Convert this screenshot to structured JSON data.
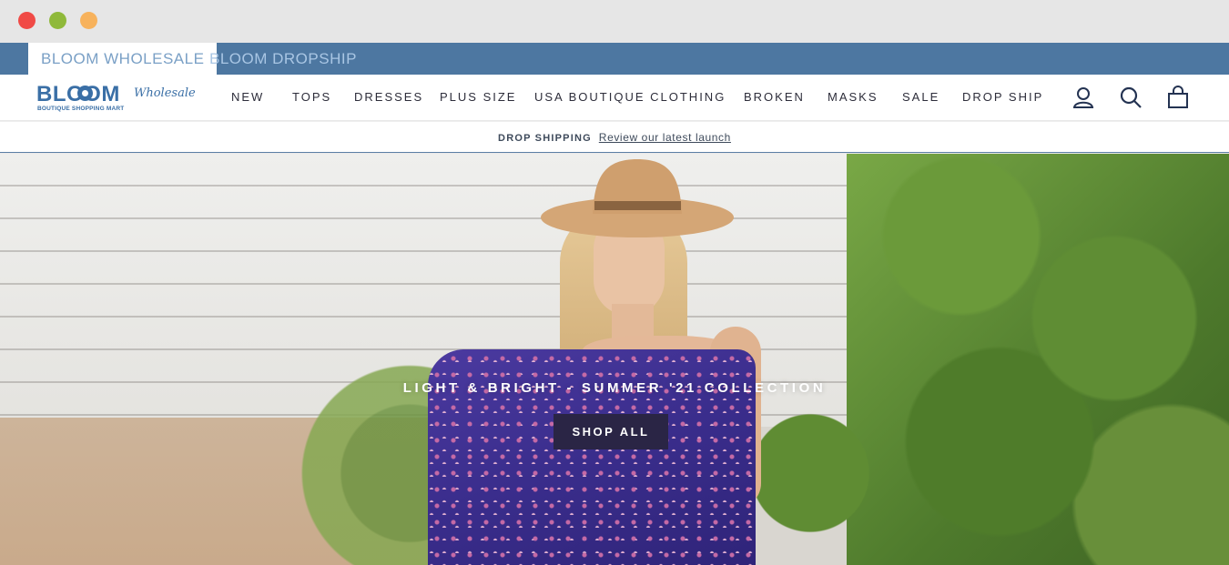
{
  "store_tabs": {
    "wholesale": "BLOOM WHOLESALE",
    "dropship": "BLOOM DROPSHIP"
  },
  "logo": {
    "main": "BLOOM",
    "script": "Wholesale",
    "tagline": "BOUTIQUE SHOPPING MART"
  },
  "nav": {
    "items": [
      "NEW",
      "TOPS",
      "DRESSES",
      "PLUS SIZE",
      "USA BOUTIQUE CLOTHING",
      "BROKEN",
      "MASKS",
      "SALE",
      "DROP SHIP"
    ]
  },
  "header_icons": [
    "account-icon",
    "search-icon",
    "cart-icon"
  ],
  "announcement": {
    "label": "DROP SHIPPING",
    "link": "Review our latest launch"
  },
  "hero": {
    "title": "LIGHT & BRIGHT - SUMMER '21 COLLECTION",
    "button": "SHOP ALL"
  },
  "colors": {
    "store_bar": "#4d77a1",
    "brand": "#3a6fa6",
    "hero_button": "#2a2545"
  }
}
